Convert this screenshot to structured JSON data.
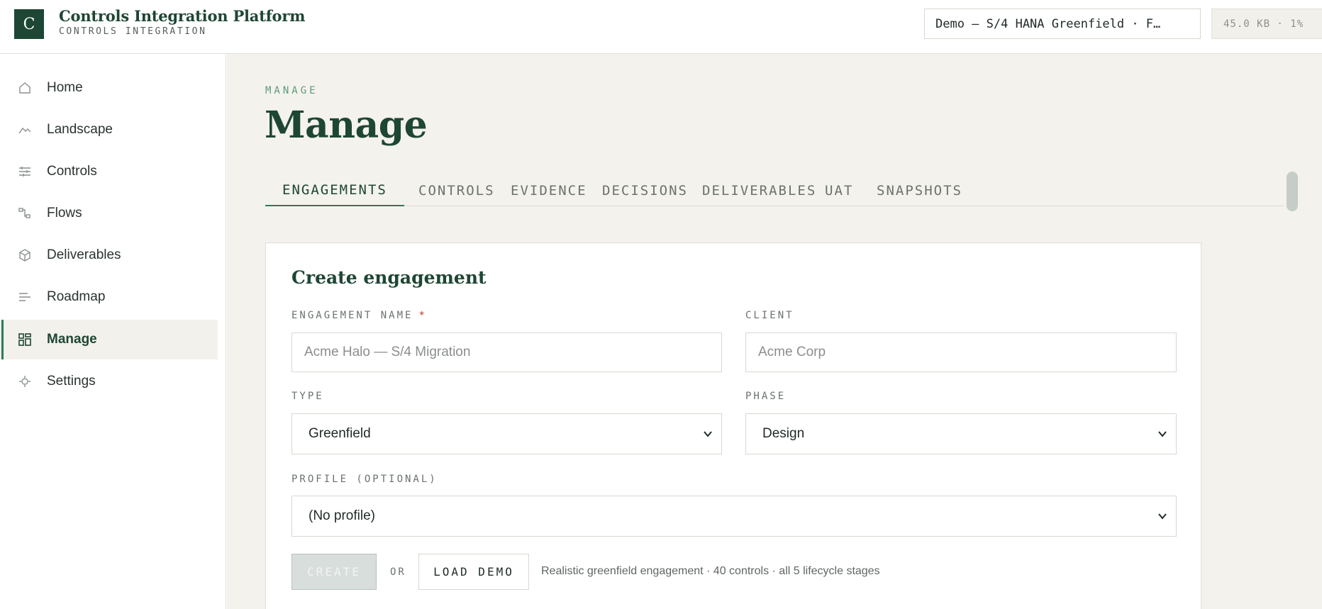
{
  "header": {
    "logo_letter": "C",
    "app_title": "Controls Integration Platform",
    "app_subtitle": "CONTROLS INTEGRATION",
    "environment": "Demo — S/4 HANA Greenfield · F…",
    "storage": "45.0 KB · 1%"
  },
  "sidebar": {
    "items": [
      {
        "label": "Home",
        "icon": "home-icon"
      },
      {
        "label": "Landscape",
        "icon": "landscape-icon"
      },
      {
        "label": "Controls",
        "icon": "sliders-icon"
      },
      {
        "label": "Flows",
        "icon": "flow-icon"
      },
      {
        "label": "Deliverables",
        "icon": "cube-icon"
      },
      {
        "label": "Roadmap",
        "icon": "roadmap-icon"
      },
      {
        "label": "Manage",
        "icon": "grid-icon",
        "active": true
      },
      {
        "label": "Settings",
        "icon": "settings-icon"
      }
    ]
  },
  "main": {
    "eyebrow": "MANAGE",
    "title": "Manage",
    "tabs": [
      {
        "label": "ENGAGEMENTS",
        "active": true
      },
      {
        "label": "CONTROLS"
      },
      {
        "label": "EVIDENCE"
      },
      {
        "label": "DECISIONS"
      },
      {
        "label": "DELIVERABLES"
      },
      {
        "label": "UAT"
      },
      {
        "label": "SNAPSHOTS"
      }
    ]
  },
  "form": {
    "title": "Create engagement",
    "engagement_name": {
      "label": "ENGAGEMENT NAME",
      "required_mark": "*",
      "placeholder": "Acme Halo — S/4 Migration"
    },
    "client": {
      "label": "CLIENT",
      "placeholder": "Acme Corp"
    },
    "type": {
      "label": "TYPE",
      "value": "Greenfield"
    },
    "phase": {
      "label": "PHASE",
      "value": "Design"
    },
    "profile": {
      "label": "PROFILE (OPTIONAL)",
      "value": "(No profile)"
    },
    "create_label": "CREATE",
    "or_label": "OR",
    "load_demo_label": "LOAD DEMO",
    "demo_note": "Realistic greenfield engagement · 40 controls · all 5 lifecycle stages"
  },
  "colors": {
    "brand": "#1e4634",
    "accent": "#2f7a55",
    "main_bg": "#f4f2ec",
    "required": "#c0392b"
  }
}
